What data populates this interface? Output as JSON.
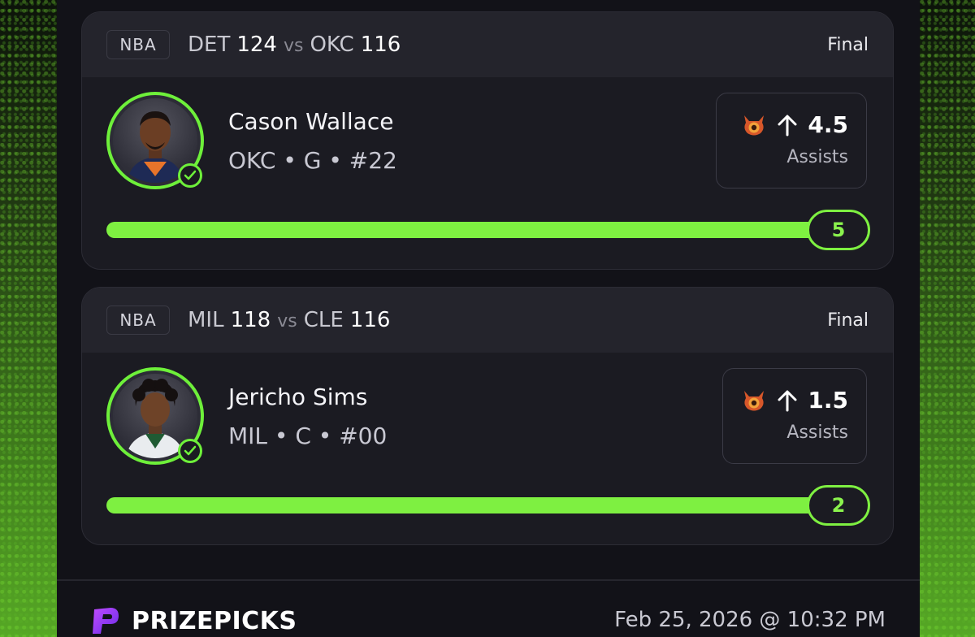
{
  "colors": {
    "accent_green": "#7ef041",
    "panel_bg": "#121218",
    "card_bg": "#1b1b22",
    "brand_purple": "#8c3cf0"
  },
  "picks": [
    {
      "league": "NBA",
      "away_team": "DET",
      "away_score": "124",
      "vs": "vs",
      "home_team": "OKC",
      "home_score": "116",
      "status": "Final",
      "player_name": "Cason Wallace",
      "player_meta": "OKC • G • #22",
      "direction_icon": "arrow-up-icon",
      "line": "4.5",
      "stat": "Assists",
      "result": "5",
      "progress_fraction": 1.0,
      "hit": true
    },
    {
      "league": "NBA",
      "away_team": "MIL",
      "away_score": "118",
      "vs": "vs",
      "home_team": "CLE",
      "home_score": "116",
      "status": "Final",
      "player_name": "Jericho Sims",
      "player_meta": "MIL • C • #00",
      "direction_icon": "arrow-up-icon",
      "line": "1.5",
      "stat": "Assists",
      "result": "2",
      "progress_fraction": 1.0,
      "hit": true
    }
  ],
  "footer": {
    "brand": "PRIZEPICKS",
    "timestamp": "Feb 25, 2026 @ 10:32 PM"
  }
}
